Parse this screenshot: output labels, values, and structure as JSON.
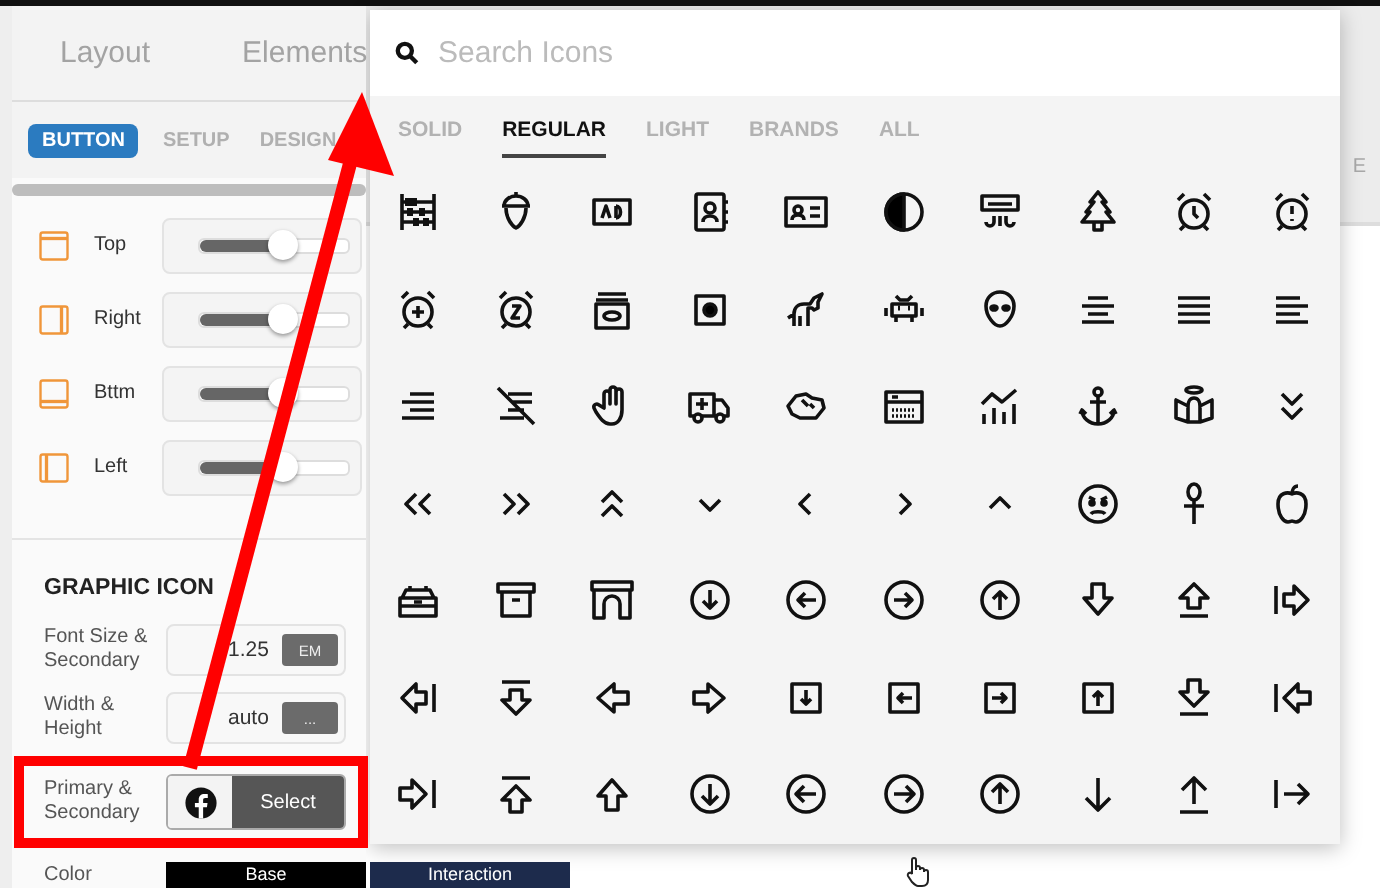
{
  "editor_panel": {
    "tabs": [
      {
        "label": "Layout",
        "selected": false
      },
      {
        "label": "Elements",
        "selected": false
      }
    ],
    "subtabs": [
      {
        "label": "BUTTON",
        "selected": true
      },
      {
        "label": "SETUP",
        "selected": false
      },
      {
        "label": "DESIGN",
        "selected": false
      }
    ],
    "spacing_rows": [
      {
        "label": "Top",
        "kind": "top",
        "level": 0.55
      },
      {
        "label": "Right",
        "kind": "right",
        "level": 0.55
      },
      {
        "label": "Bttm",
        "kind": "bottom",
        "level": 0.55
      },
      {
        "label": "Left",
        "kind": "left",
        "level": 0.55
      }
    ],
    "section_title": "GRAPHIC ICON",
    "fields": [
      {
        "kind": "input",
        "label": "Font Size & Secondary",
        "value": "1.25",
        "button": "EM",
        "highlighted": false
      },
      {
        "kind": "input",
        "label": "Width & Height",
        "value": "auto",
        "button": "...",
        "highlighted": false
      },
      {
        "kind": "icon_select",
        "label": "Primary & Secondary",
        "button": "Select",
        "highlighted": true
      },
      {
        "kind": "color",
        "label": "Color",
        "highlighted": false,
        "swatches": [
          {
            "label": "Base",
            "color": "#000000"
          },
          {
            "label": "Interaction",
            "color": "#1d2b4c"
          }
        ]
      }
    ]
  },
  "background_panel": {
    "heading_fragment": "E"
  },
  "icon_picker": {
    "search": {
      "placeholder": "Search Icons"
    },
    "tabs": [
      {
        "label": "SOLID",
        "selected": false
      },
      {
        "label": "REGULAR",
        "selected": true
      },
      {
        "label": "LIGHT",
        "selected": false
      },
      {
        "label": "BRANDS",
        "selected": false
      },
      {
        "label": "ALL",
        "selected": false
      }
    ]
  }
}
